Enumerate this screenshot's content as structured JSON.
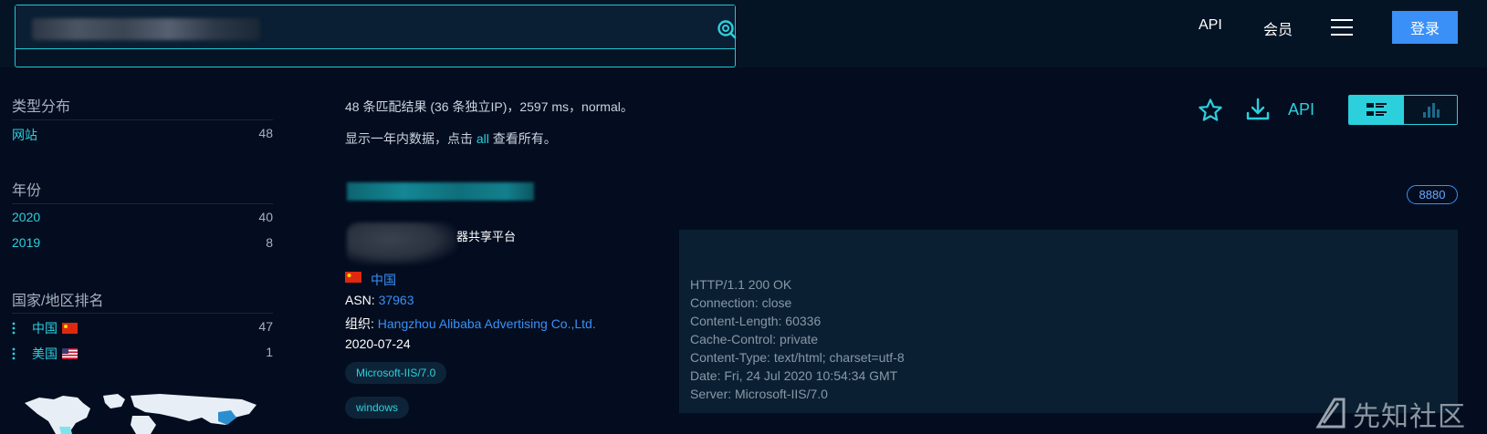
{
  "header": {
    "search_value": "",
    "nav_api": "API",
    "nav_member": "会员",
    "login": "登录"
  },
  "sidebar": {
    "type_title": "类型分布",
    "types": [
      {
        "label": "网站",
        "count": "48"
      }
    ],
    "year_title": "年份",
    "years": [
      {
        "label": "2020",
        "count": "40"
      },
      {
        "label": "2019",
        "count": "8"
      }
    ],
    "country_title": "国家/地区排名",
    "countries": [
      {
        "label": "中国",
        "count": "47"
      },
      {
        "label": "美国",
        "count": "1"
      }
    ]
  },
  "main": {
    "summary": "48 条匹配结果 (36 条独立IP)，2597 ms，normal。",
    "hint_prefix": "显示一年内数据，点击 ",
    "hint_link": "all",
    "hint_suffix": " 查看所有。",
    "api_label": "API",
    "result": {
      "port": "8880",
      "title_suffix": "器共享平台",
      "country": "中国",
      "asn_label": "ASN:",
      "asn": "37963",
      "org_label": "组织:",
      "org": "Hangzhou Alibaba Advertising Co.,Ltd.",
      "date": "2020-07-24",
      "tags": [
        "Microsoft-IIS/7.0",
        "windows"
      ],
      "response": [
        "HTTP/1.1 200 OK",
        "Connection: close",
        "Content-Length: 60336",
        "Cache-Control: private",
        "Content-Type: text/html; charset=utf-8",
        "Date: Fri, 24 Jul 2020 10:54:34 GMT",
        "Server: Microsoft-IIS/7.0"
      ]
    }
  },
  "watermark": "先知社区",
  "colors": {
    "accent": "#2cd0dd",
    "link": "#3b90f7",
    "background": "#030d1f"
  }
}
